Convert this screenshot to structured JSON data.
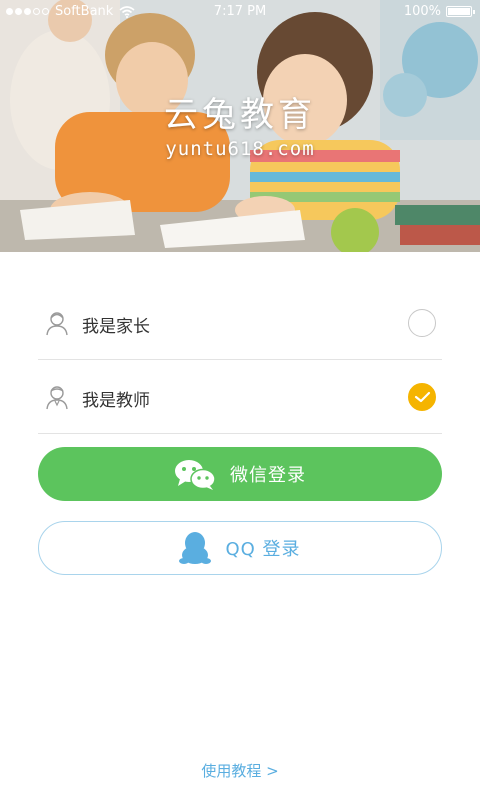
{
  "status_bar": {
    "carrier": "SoftBank",
    "time": "7:17 PM",
    "battery": "100%",
    "signal_bars_filled": 3,
    "signal_bars_total": 5
  },
  "brand": {
    "name": "云兔教育",
    "url": "yuntu618.com"
  },
  "roles": [
    {
      "label": "我是家长",
      "icon": "parent-icon",
      "selected": false
    },
    {
      "label": "我是教师",
      "icon": "teacher-icon",
      "selected": true
    }
  ],
  "login": {
    "wechat_label": "微信登录",
    "qq_label": "QQ 登录"
  },
  "footer": {
    "tutorial_link": "使用教程 >"
  },
  "colors": {
    "wechat_green": "#5cc45d",
    "qq_blue": "#5aaee0",
    "selected_orange": "#f5b400"
  }
}
